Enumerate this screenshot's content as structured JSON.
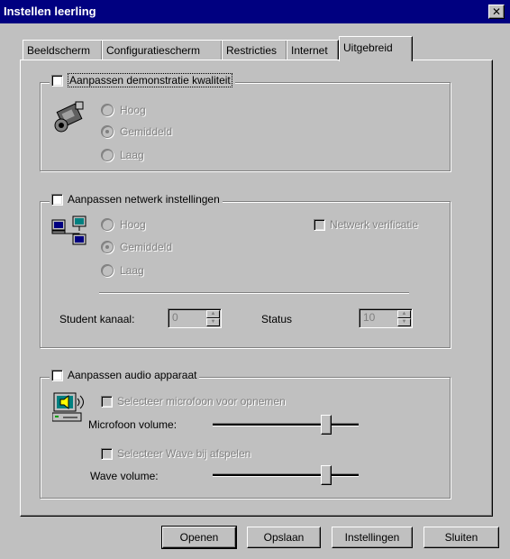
{
  "window": {
    "title": "Instellen leerling",
    "close_icon": "close-icon",
    "close_glyph": "✕"
  },
  "tabs": [
    {
      "label": "Beeldscherm"
    },
    {
      "label": "Configuratiescherm"
    },
    {
      "label": "Restricties"
    },
    {
      "label": "Internet"
    },
    {
      "label": "Uitgebreid",
      "active": true
    }
  ],
  "demo_quality": {
    "label": "Aanpassen demonstratie kwaliteit",
    "checked": false,
    "icon": "video-camera-icon",
    "options": [
      "Hoog",
      "Gemiddeld",
      "Laag"
    ],
    "selected": "Gemiddeld"
  },
  "network": {
    "label": "Aanpassen netwerk instellingen",
    "checked": false,
    "icon": "network-computers-icon",
    "options": [
      "Hoog",
      "Gemiddeld",
      "Laag"
    ],
    "selected": "Gemiddeld",
    "verification_label": "Netwerk verificatie",
    "student_channel_label": "Student kanaal:",
    "student_channel_value": "0",
    "status_label": "Status",
    "status_value": "10"
  },
  "audio": {
    "label": "Aanpassen audio apparaat",
    "checked": false,
    "icon": "speaker-computer-icon",
    "select_mic_label": "Selecteer microfoon voor opnemen",
    "mic_volume_label": "Microfoon volume:",
    "select_wave_label": "Selecteer Wave bij afspelen",
    "wave_volume_label": "Wave volume:"
  },
  "buttons": {
    "open": "Openen",
    "save": "Opslaan",
    "settings": "Instellingen",
    "close": "Sluiten"
  },
  "colors": {
    "titlebar": "#000080",
    "face": "#c0c0c0",
    "disabled_text": "#808080"
  }
}
